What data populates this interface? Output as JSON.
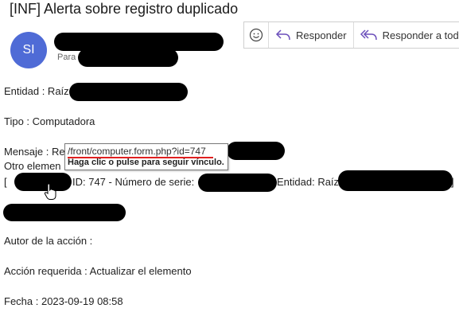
{
  "email": {
    "subject": "[INF] Alerta sobre registro duplicado",
    "avatar_initials": "SI",
    "avatar_color": "#4f6bd6",
    "to_label": "Para"
  },
  "toolbar": {
    "reply_label": "Responder",
    "reply_all_label": "Responder a todos",
    "accent_color": "#6b4fbb"
  },
  "body": {
    "entity_line": "Entidad : Raíz",
    "type_line": "Tipo : Computadora",
    "message_prefix": "Mensaje : Re",
    "other_prefix": "Otro elemen",
    "row_open": "[",
    "row_id": "ID: 747 - Número de serie:",
    "row_entity": "Entidad: Raíz",
    "row_close": "]",
    "author_line": "Autor de la acción :",
    "action_line": "Acción requerida : Actualizar el elemento",
    "date_line": "Fecha : 2023-09-19 08:58"
  },
  "tooltip": {
    "url": "/front/computer.form.php?id=747",
    "hint": "Haga clic o pulse para seguir vínculo."
  }
}
